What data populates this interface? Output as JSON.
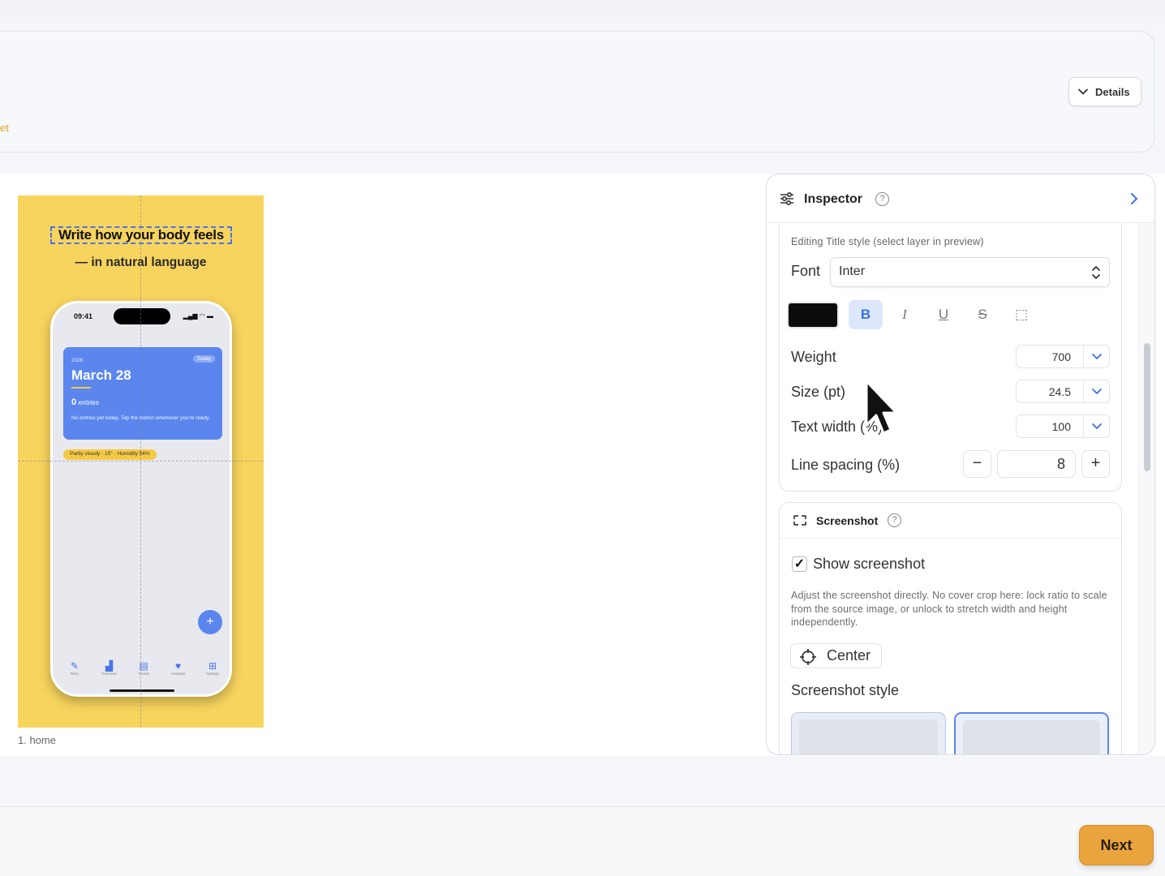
{
  "header": {
    "preset_fragment": "et",
    "details_label": "Details"
  },
  "preview": {
    "title": "Write how your body feels",
    "subtitle": "— in natural language",
    "phone": {
      "time": "09:41",
      "status": "▂▄▆ ◠ ▬",
      "year": "2026",
      "today_badge": "Today",
      "date": "March 28",
      "entries_count": "0",
      "entries_label": "entries",
      "note": "No entries yet today. Tap the button whenever you're ready.",
      "weather": "Partly cloudy · 15° · Humidity 54%",
      "fab": "+",
      "tabs": [
        {
          "icon": "✎",
          "label": "Diary"
        },
        {
          "icon": "▟",
          "label": "Overview"
        },
        {
          "icon": "▤",
          "label": "Trends"
        },
        {
          "icon": "♥",
          "label": "Assistant"
        },
        {
          "icon": "⊞",
          "label": "Settings"
        }
      ]
    },
    "caption": "1. home"
  },
  "inspector": {
    "title": "Inspector",
    "help": "?",
    "editing_caption": "Editing Title style (select layer in preview)",
    "font_label": "Font",
    "font_value": "Inter",
    "text_color": "#0c0c0c",
    "style_buttons": [
      "B",
      "I",
      "U",
      "S",
      "⬚"
    ],
    "weight_label": "Weight",
    "weight_value": "700",
    "size_label": "Size (pt)",
    "size_value": "24.5",
    "text_width_label": "Text width (%)",
    "text_width_value": "100",
    "line_spacing_label": "Line spacing (%)",
    "line_spacing_value": "8",
    "minus": "−",
    "plus": "+",
    "screenshot": {
      "title": "Screenshot",
      "help": "?",
      "show_checked": "✓",
      "show_label": "Show screenshot",
      "description": "Adjust the screenshot directly. No cover crop here: lock ratio to scale from the source image, or unlock to stretch width and height independently.",
      "center_label": "Center",
      "style_label": "Screenshot style"
    }
  },
  "footer": {
    "next_label": "Next"
  },
  "colors": {
    "accent": "#5b86ee",
    "preview_bg": "#f7d45e",
    "next_button": "#e9a43d"
  }
}
